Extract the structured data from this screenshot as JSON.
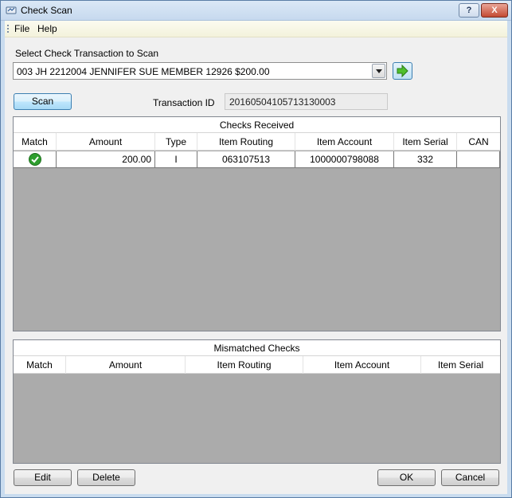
{
  "window": {
    "title": "Check Scan",
    "help_glyph": "?",
    "close_glyph": "X"
  },
  "menu": {
    "items": [
      "File",
      "Help"
    ]
  },
  "select": {
    "label": "Select Check Transaction to Scan",
    "value": "003 JH 2212004 JENNIFER SUE MEMBER 12926 $200.00"
  },
  "scan": {
    "label": "Scan"
  },
  "transaction": {
    "label": "Transaction ID",
    "value": "20160504105713130003"
  },
  "checks_received": {
    "title": "Checks Received",
    "columns": [
      "Match",
      "Amount",
      "Type",
      "Item Routing",
      "Item Account",
      "Item Serial",
      "CAN"
    ],
    "rows": [
      {
        "match": "check-mark",
        "amount": "200.00",
        "type": "I",
        "routing": "063107513",
        "account": "1000000798088",
        "serial": "332",
        "can": ""
      }
    ]
  },
  "mismatched_checks": {
    "title": "Mismatched Checks",
    "columns": [
      "Match",
      "Amount",
      "Item Routing",
      "Item Account",
      "Item Serial"
    ],
    "rows": []
  },
  "buttons": {
    "edit": "Edit",
    "delete": "Delete",
    "ok": "OK",
    "cancel": "Cancel"
  },
  "colors": {
    "match_ok": "#2e9e2e",
    "go_arrow": "#3fae2a"
  }
}
